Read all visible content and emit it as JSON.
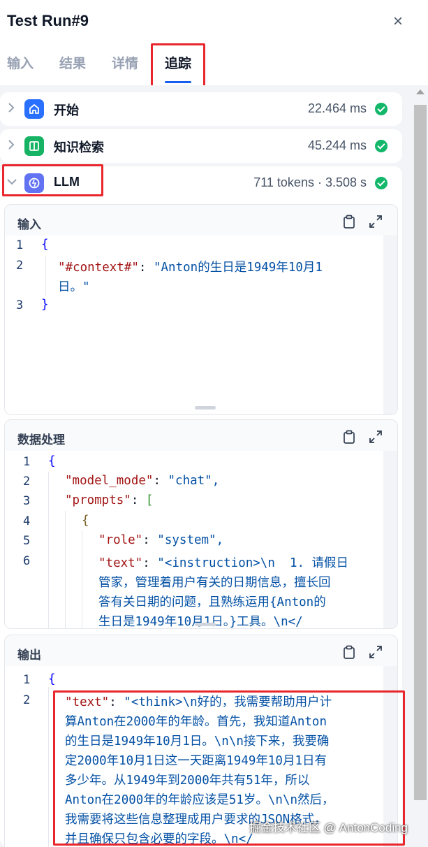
{
  "header": {
    "title": "Test Run#9",
    "close_label": "×"
  },
  "tabs": [
    {
      "label": "输入"
    },
    {
      "label": "结果"
    },
    {
      "label": "详情"
    },
    {
      "label": "追踪"
    }
  ],
  "nodes": [
    {
      "label": "开始",
      "time": "22.464 ms",
      "icon": "home-icon",
      "icon_color": "#2970ff"
    },
    {
      "label": "知识检索",
      "time": "45.244 ms",
      "icon": "book-icon",
      "icon_color": "#16b364"
    },
    {
      "label": "LLM",
      "time": "711 tokens · 3.508 s",
      "icon": "llm-icon",
      "icon_color": "#6172f3"
    }
  ],
  "sections": {
    "input": {
      "title": "输入",
      "lines": [
        {
          "n": "1",
          "text": "{"
        },
        {
          "n": "2",
          "key": "\"#context#\"",
          "value": "\"Anton的生日是1949年10月1",
          "cont": "日。\""
        },
        {
          "n": "3",
          "text": "}"
        }
      ]
    },
    "process": {
      "title": "数据处理",
      "lines": [
        {
          "n": "1",
          "text": "{"
        },
        {
          "n": "2",
          "key": "\"model_mode\"",
          "value": "\"chat\","
        },
        {
          "n": "3",
          "key": "\"prompts\"",
          "value": "["
        },
        {
          "n": "4",
          "text": "{"
        },
        {
          "n": "5",
          "key": "\"role\"",
          "value": "\"system\","
        },
        {
          "n": "6",
          "key": "\"text\"",
          "value": "\"<instruction>\\n  1. 请假日",
          "cont1": "管家，管理着用户有关的日期信息，擅长回",
          "cont2": "答有关日期的问题，且熟练运用{Anton的",
          "cont3": "生日是1949年10月1日。}工具。\\n</"
        }
      ]
    },
    "output": {
      "title": "输出",
      "lines": [
        {
          "n": "1",
          "text": "{"
        },
        {
          "n": "2",
          "key": "\"text\"",
          "value": "\"<think>\\n好的，我需要帮助用户计",
          "cont1": "算Anton在2000年的年龄。首先，我知道Anton",
          "cont2": "的生日是1949年10月1日。\\n\\n接下来，我要确",
          "cont3": "定2000年10月1日这一天距离1949年10月1日有",
          "cont4": "多少年。从1949年到2000年共有51年，所以",
          "cont5": "Anton在2000年的年龄应该是51岁。\\n\\n然后，",
          "cont6": "我需要将这些信息整理成用户要求的JSON格式，",
          "cont7": "并且确保只包含必要的字段。\\n</"
        }
      ]
    }
  },
  "watermark": "掘金技术社区 @ AntonCoding",
  "colors": {
    "accent": "#155eef",
    "success": "#12b76a",
    "highlight": "#e8262c"
  }
}
